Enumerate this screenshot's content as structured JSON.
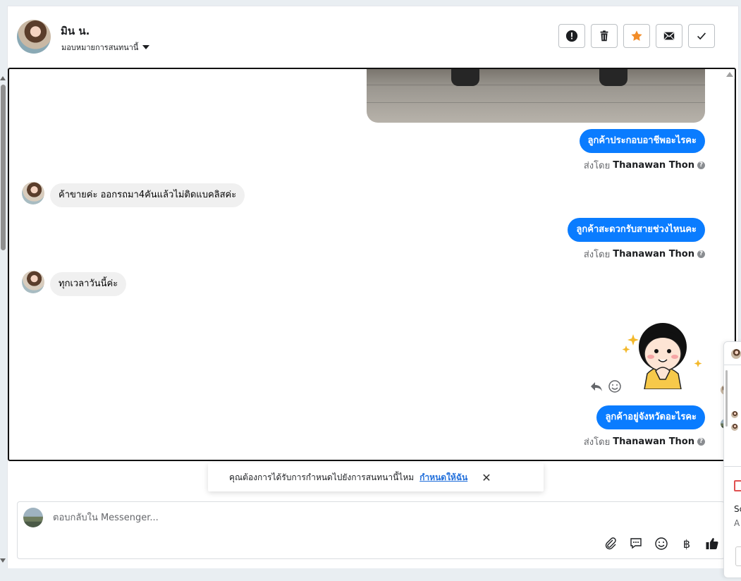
{
  "header": {
    "contact_name": "มิน น.",
    "assign_label": "มอบหมายการสนทนานี้",
    "buttons": [
      "alert-icon",
      "trash-icon",
      "star-icon",
      "mail-icon",
      "check-icon"
    ]
  },
  "messages": {
    "out1": "ลูกค้าประกอบอาชีพอะไรคะ",
    "sent_prefix": "ส่งโดย",
    "sent_by": "Thanawan Thon",
    "in1": "ค้าขายค่ะ ออกรถมา4คันแล้วไม่ติดแบคลิสค่ะ",
    "out2": "ลูกค้าสะดวกรับสายช่วงไหนคะ",
    "in2": "ทุกเวลาวันนี้ค่ะ",
    "out3": "ลูกค้าอยู่จังหวัดอะไรคะ",
    "help_mark": "?"
  },
  "toast": {
    "text": "คุณต้องการได้รับการกำหนดไปยังการสนทนานี้ไหม",
    "link": "กำหนดให้ฉัน",
    "close": "✕"
  },
  "composer": {
    "placeholder": "ตอบกลับใน Messenger...",
    "baht_symbol": "฿"
  },
  "peek": {
    "t1": "Sc",
    "t2": "A"
  },
  "colors": {
    "brand_blue": "#0a7cff",
    "star": "#f28c28"
  }
}
